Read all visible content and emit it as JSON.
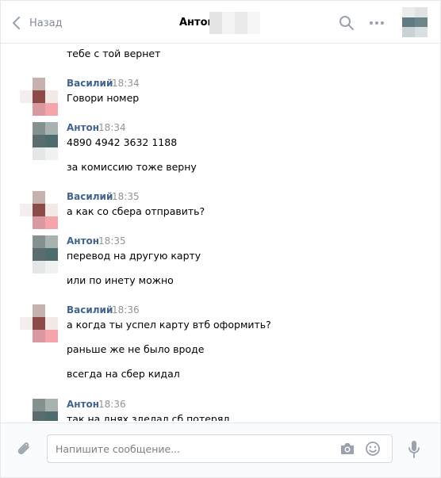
{
  "header": {
    "back_label": "Назад",
    "title": "Антон"
  },
  "messages": {
    "top_line": "тебе с той вернет",
    "groups": [
      {
        "author": "Василий",
        "time": "18:34",
        "lines": [
          "Говори номер"
        ]
      },
      {
        "author": "Антон",
        "time": "18:34",
        "lines": [
          "4890 4942 3632 1188",
          "за комиссию тоже верну"
        ]
      },
      {
        "author": "Василий",
        "time": "18:35",
        "lines": [
          "а как со сбера отправить?"
        ]
      },
      {
        "author": "Антон",
        "time": "18:35",
        "lines": [
          "перевод на другую карту",
          "или по инету можно"
        ]
      },
      {
        "author": "Василий",
        "time": "18:36",
        "lines": [
          "а когда ты успел карту втб оформить?",
          "раньше же не было вроде",
          "всегда на сбер кидал"
        ]
      },
      {
        "author": "Антон",
        "time": "18:36",
        "lines": [
          "так на днях зделал сб потерял"
        ]
      }
    ]
  },
  "composer": {
    "placeholder": "Напишите сообщение..."
  },
  "colors": {
    "author_name": "#42648b",
    "time": "#939393",
    "icon": "#99a2ad"
  },
  "icons": [
    "chevron-left-icon",
    "search-icon",
    "more-dots-icon",
    "paperclip-icon",
    "camera-icon",
    "smile-icon",
    "microphone-icon"
  ]
}
